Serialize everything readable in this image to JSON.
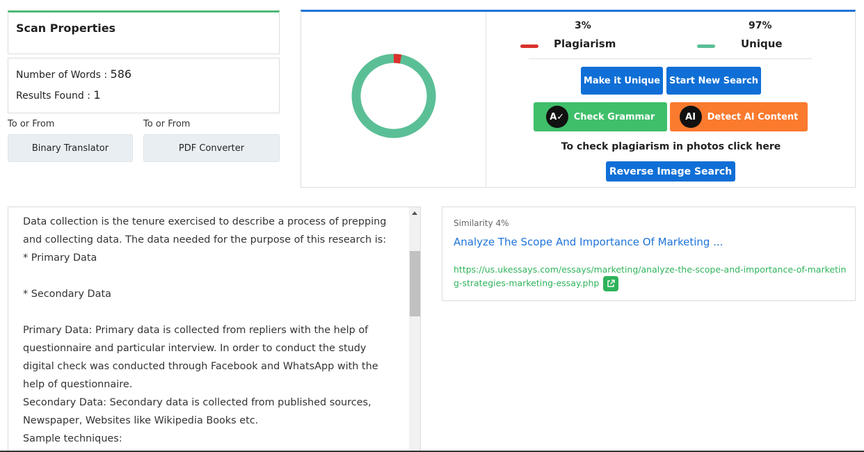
{
  "scan_properties": {
    "title": "Scan Properties",
    "words_label": "Number of Words : ",
    "words_value": "586",
    "results_label": "Results Found : ",
    "results_value": "1"
  },
  "tools": [
    {
      "caption": "To or From",
      "label": "Binary Translator"
    },
    {
      "caption": "To or From",
      "label": "PDF Converter"
    }
  ],
  "result": {
    "plagiarism_percent": "3%",
    "unique_percent": "97%",
    "plagiarism_label": "Plagiarism",
    "unique_label": "Unique",
    "plagiarism_fraction": 0.03,
    "colors": {
      "plagiarism": "#d9312c",
      "unique": "#5bbf96"
    }
  },
  "actions": {
    "make_unique": "Make it Unique",
    "start_new_search": "Start New Search",
    "check_grammar": "Check Grammar",
    "detect_ai": "Detect AI Content",
    "photo_text": "To check plagiarism in photos click here",
    "reverse_image": "Reverse Image Search"
  },
  "content_text": [
    "Data collection is the tenure exercised to describe a process of prepping",
    "and collecting data. The data needed for the purpose of this research is:",
    "* Primary Data",
    "",
    "* Secondary Data",
    "",
    "Primary Data: Primary data is collected from repliers with the help of",
    "questionnaire and particular interview. In order to conduct the study",
    "digital check was conducted through Facebook and WhatsApp with the",
    "help of questionnaire.",
    "Secondary Data: Secondary data is collected from published sources,",
    "Newspaper, Websites like Wikipedia Books etc.",
    "Sample techniques:"
  ],
  "similarity": {
    "label": "Similarity 4%",
    "title": "Analyze The Scope And Importance Of Marketing ...",
    "url": "https://us.ukessays.com/essays/marketing/analyze-the-scope-and-importance-of-marketing-strategies-marketing-essay.php"
  }
}
